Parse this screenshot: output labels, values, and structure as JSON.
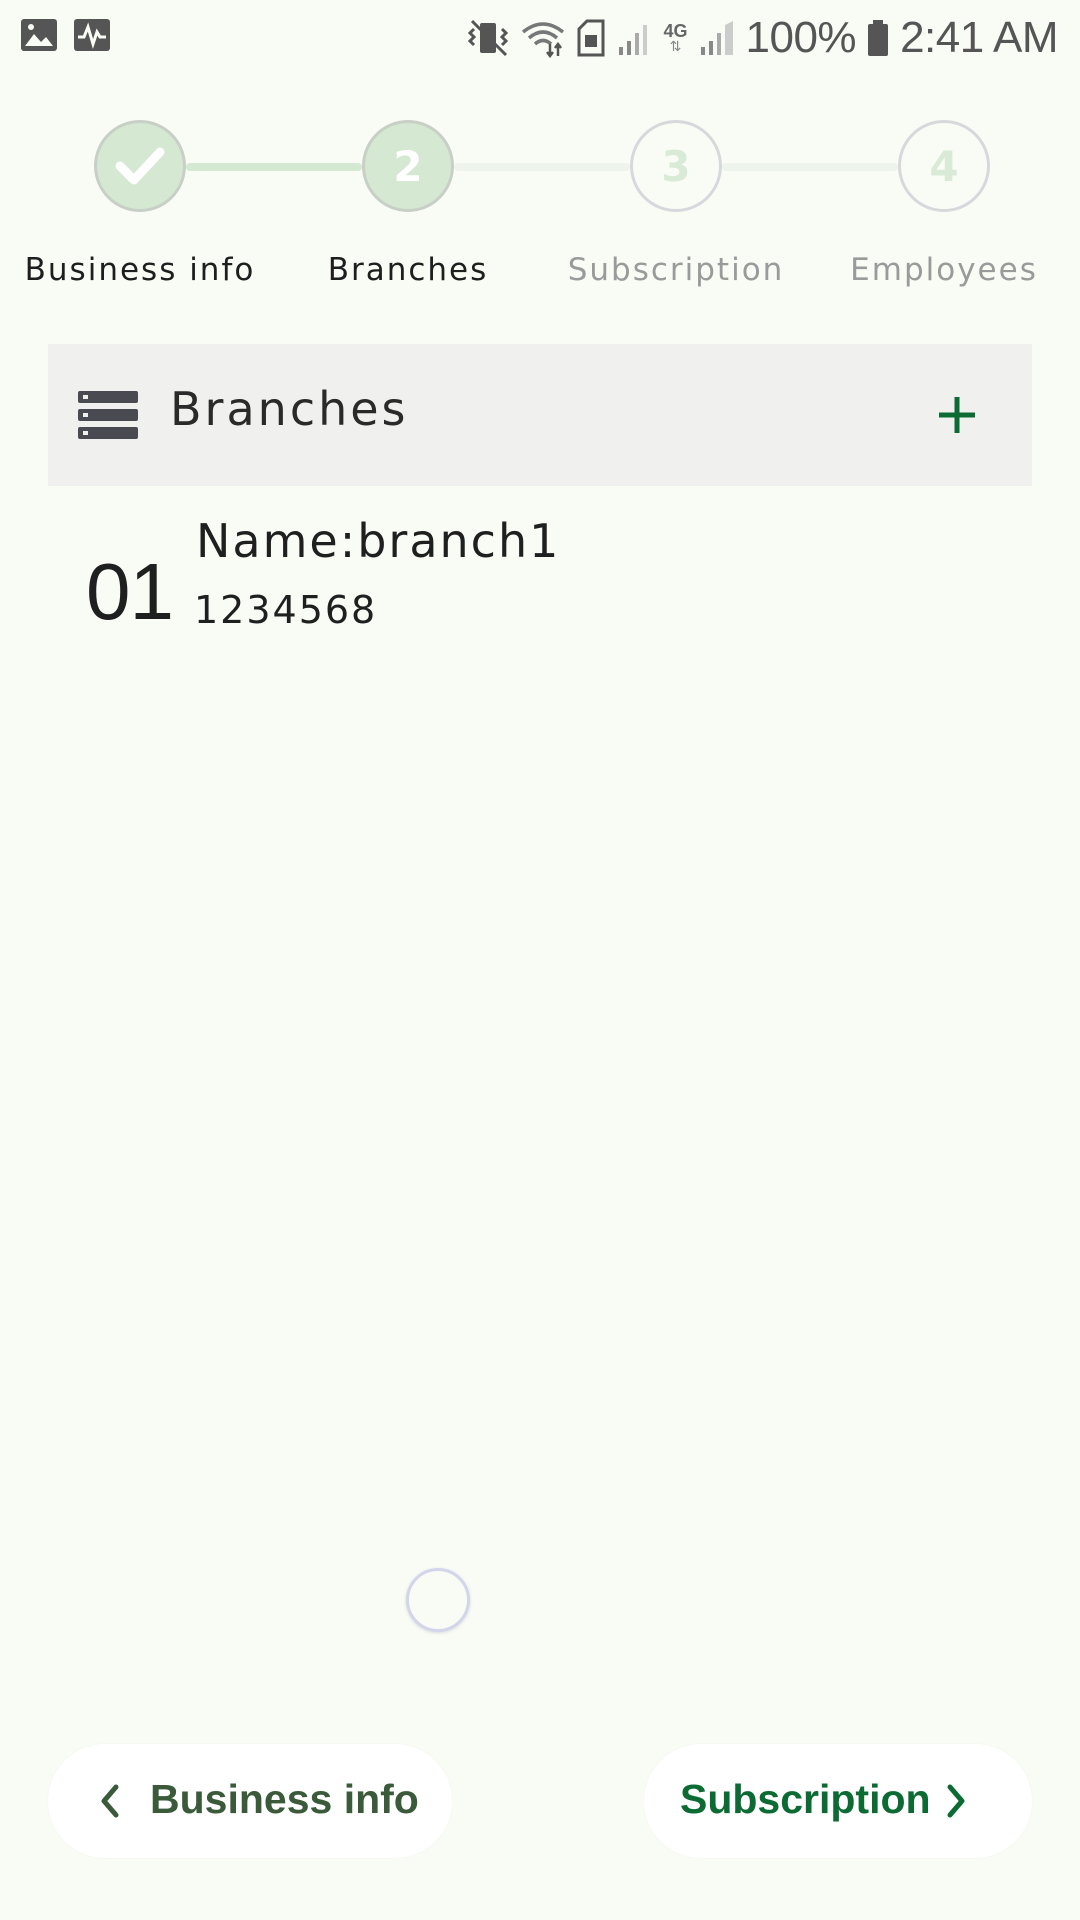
{
  "status_bar": {
    "battery_percent": "100%",
    "time": "2:41 AM",
    "network_label": "4G",
    "icons": [
      "image-icon",
      "activity-icon",
      "vibrate-icon",
      "wifi-icon",
      "sim-icon",
      "signal-icon",
      "battery-icon"
    ]
  },
  "stepper": {
    "steps": [
      {
        "label": "Business info",
        "marker": "",
        "state": "done"
      },
      {
        "label": "Branches",
        "marker": "2",
        "state": "active"
      },
      {
        "label": "Subscription",
        "marker": "3",
        "state": "pending"
      },
      {
        "label": "Employees",
        "marker": "4",
        "state": "pending"
      }
    ]
  },
  "branches_panel": {
    "title": "Branches",
    "add_icon": "plus-icon",
    "list_icon": "list-icon"
  },
  "branches": [
    {
      "index": "01",
      "name": "Name:branch1",
      "phone": "1234568"
    }
  ],
  "navigation": {
    "prev_label": "Business info",
    "next_label": "Subscription"
  },
  "colors": {
    "background": "#f9fcf5",
    "accent_green": "#0c6a33",
    "step_fill": "#d4e8d2",
    "header_bg": "#f0f1ee"
  }
}
